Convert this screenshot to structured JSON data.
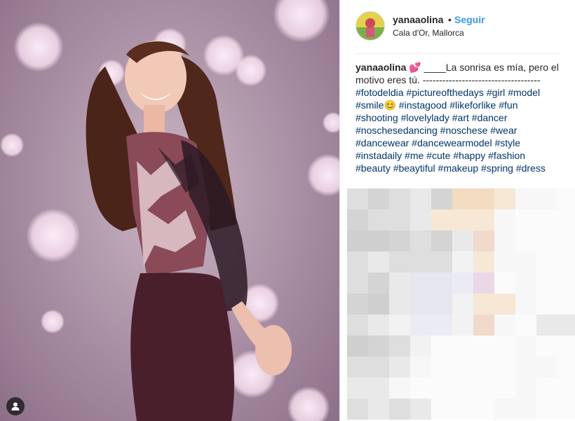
{
  "post": {
    "username": "yanaaolina",
    "separator": "•",
    "follow_label": "Seguir",
    "location": "Cala d'Or, Mallorca"
  },
  "caption": {
    "username": "yanaaolina",
    "emoji_heart": "💕",
    "text": "____La sonrisa es mía, pero el motivo eres tú. ------------------------------------",
    "hashtags": [
      "#fotodeldia",
      "#pictureofthedays",
      "#girl",
      "#model",
      "#smile",
      "#instagood",
      "#likeforlike",
      "#fun",
      "#shooting",
      "#lovelylady",
      "#art",
      "#dancer",
      "#noschesedancing",
      "#noschese",
      "#wear",
      "#dancewear",
      "#dancewearmodel",
      "#style",
      "#instadaily",
      "#me",
      "#cute",
      "#happy",
      "#fashion",
      "#beauty",
      "#beaytiful",
      "#makeup",
      "#spring",
      "#dress"
    ],
    "smile_emoji": "😊"
  },
  "icons": {
    "tagged_users": "user-icon"
  },
  "colors": {
    "link": "#003569",
    "follow": "#3897f0",
    "text": "#262626"
  }
}
